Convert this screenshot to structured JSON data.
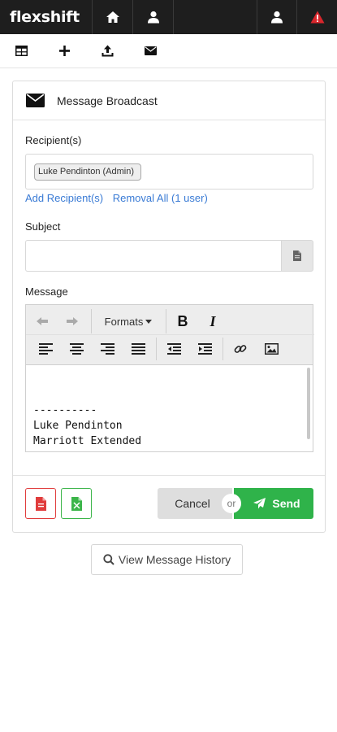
{
  "app": {
    "brand": "flexshift"
  },
  "topbar": {
    "icons": [
      "home-icon",
      "user-icon",
      "user-icon",
      "warning-icon"
    ],
    "warning_color": "#d9262c"
  },
  "toolbar": {
    "icons": [
      "table-icon",
      "plus-icon",
      "upload-icon",
      "envelope-icon"
    ]
  },
  "panel": {
    "title": "Message Broadcast",
    "recipients_label": "Recipient(s)",
    "recipients": [
      {
        "label": "Luke Pendinton (Admin)"
      }
    ],
    "add_link": "Add Recipient(s)",
    "remove_link": "Removal All (1 user)",
    "subject_label": "Subject",
    "subject_value": "",
    "message_label": "Message",
    "editor": {
      "formats_label": "Formats",
      "bold_label": "B",
      "italic_label": "I",
      "body_lines": [
        "----------",
        "Luke Pendinton",
        "Marriott Extended"
      ]
    },
    "cancel_label": "Cancel",
    "or_label": "or",
    "send_label": "Send"
  },
  "history_button": "View Message History",
  "colors": {
    "accent_blue": "#3a7bd5",
    "send_green": "#2fb34a",
    "danger_red": "#d9262c",
    "pdf_red": "#e03c3c",
    "excel_green": "#3cb54a"
  }
}
